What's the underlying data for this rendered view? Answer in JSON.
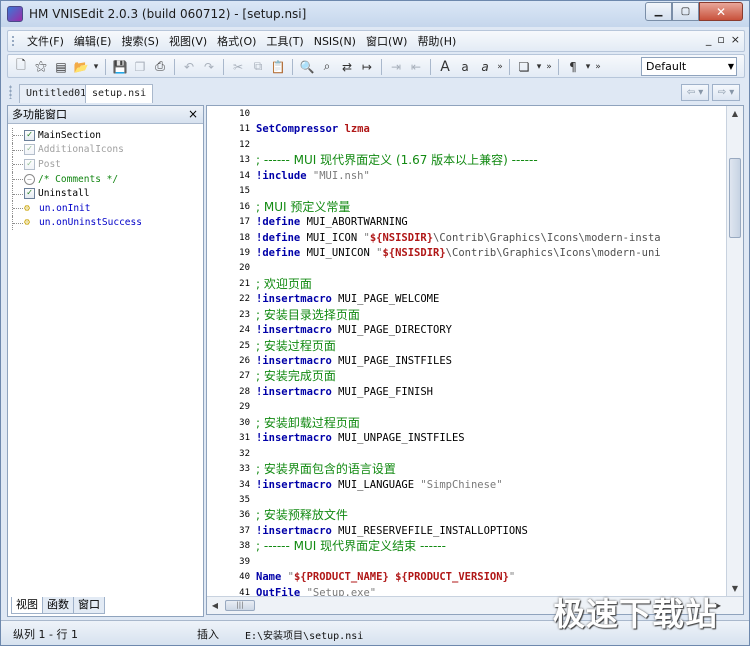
{
  "window": {
    "title": "HM VNISEdit 2.0.3 (build 060712) - [setup.nsi]"
  },
  "menu": {
    "items": [
      "文件(F)",
      "编辑(E)",
      "搜索(S)",
      "视图(V)",
      "格式(O)",
      "工具(T)",
      "NSIS(N)",
      "窗口(W)",
      "帮助(H)"
    ],
    "mdi_buttons": [
      "_",
      "▫",
      "×"
    ]
  },
  "toolbar": {
    "text_buttons": [
      "A",
      "a",
      "a"
    ],
    "paragraph_label": "¶",
    "font_select": "Default"
  },
  "tabs": [
    {
      "label": "Untitled01",
      "active": false
    },
    {
      "label": "setup.nsi",
      "active": true
    }
  ],
  "panel": {
    "title": "多功能窗口",
    "close": "×",
    "tree": [
      {
        "label": "MainSection",
        "style": "black",
        "icon": "checkbox-icon",
        "checked": true
      },
      {
        "label": "AdditionalIcons",
        "style": "gray",
        "icon": "checkbox-icon",
        "checked": true
      },
      {
        "label": "Post",
        "style": "gray",
        "icon": "checkbox-icon",
        "checked": true
      },
      {
        "label": "/* Comments */",
        "style": "green",
        "icon": "comment-icon",
        "checked": false
      },
      {
        "label": "Uninstall",
        "style": "black",
        "icon": "checkbox-icon",
        "checked": true
      },
      {
        "label": "un.onInit",
        "style": "blue",
        "icon": "function-icon",
        "checked": false
      },
      {
        "label": "un.onUninstSuccess",
        "style": "blue",
        "icon": "function-icon",
        "checked": false
      }
    ],
    "bottom_tabs": [
      "视图",
      "函数",
      "窗口"
    ]
  },
  "editor": {
    "lines": [
      {
        "n": "10",
        "parts": []
      },
      {
        "n": "11",
        "parts": [
          [
            "kw",
            "SetCompressor"
          ],
          [
            "id",
            " "
          ],
          [
            "var",
            "lzma"
          ]
        ]
      },
      {
        "n": "12",
        "parts": []
      },
      {
        "n": "13",
        "cjk": true,
        "parts": [
          [
            "cm",
            "; ------ MUI 现代界面定义 (1.67 版本以上兼容) ------"
          ]
        ]
      },
      {
        "n": "14",
        "parts": [
          [
            "kw",
            "!include"
          ],
          [
            "id",
            " "
          ],
          [
            "str",
            "\"MUI.nsh\""
          ]
        ]
      },
      {
        "n": "15",
        "parts": []
      },
      {
        "n": "16",
        "cjk": true,
        "parts": [
          [
            "cm",
            "; MUI 预定义常量"
          ]
        ]
      },
      {
        "n": "17",
        "parts": [
          [
            "kw",
            "!define"
          ],
          [
            "id",
            " MUI_ABORTWARNING"
          ]
        ]
      },
      {
        "n": "18",
        "parts": [
          [
            "kw",
            "!define"
          ],
          [
            "id",
            " MUI_ICON "
          ],
          [
            "str",
            "\""
          ],
          [
            "var",
            "${NSISDIR}"
          ],
          [
            "path",
            "\\Contrib\\Graphics\\Icons\\modern-insta"
          ]
        ]
      },
      {
        "n": "19",
        "parts": [
          [
            "kw",
            "!define"
          ],
          [
            "id",
            " MUI_UNICON "
          ],
          [
            "str",
            "\""
          ],
          [
            "var",
            "${NSISDIR}"
          ],
          [
            "path",
            "\\Contrib\\Graphics\\Icons\\modern-uni"
          ]
        ]
      },
      {
        "n": "20",
        "parts": []
      },
      {
        "n": "21",
        "cjk": true,
        "parts": [
          [
            "cm",
            "; 欢迎页面"
          ]
        ]
      },
      {
        "n": "22",
        "parts": [
          [
            "kw",
            "!insertmacro"
          ],
          [
            "id",
            " MUI_PAGE_WELCOME"
          ]
        ]
      },
      {
        "n": "23",
        "cjk": true,
        "parts": [
          [
            "cm",
            "; 安装目录选择页面"
          ]
        ]
      },
      {
        "n": "24",
        "parts": [
          [
            "kw",
            "!insertmacro"
          ],
          [
            "id",
            " MUI_PAGE_DIRECTORY"
          ]
        ]
      },
      {
        "n": "25",
        "cjk": true,
        "parts": [
          [
            "cm",
            "; 安装过程页面"
          ]
        ]
      },
      {
        "n": "26",
        "parts": [
          [
            "kw",
            "!insertmacro"
          ],
          [
            "id",
            " MUI_PAGE_INSTFILES"
          ]
        ]
      },
      {
        "n": "27",
        "cjk": true,
        "parts": [
          [
            "cm",
            "; 安装完成页面"
          ]
        ]
      },
      {
        "n": "28",
        "parts": [
          [
            "kw",
            "!insertmacro"
          ],
          [
            "id",
            " MUI_PAGE_FINISH"
          ]
        ]
      },
      {
        "n": "29",
        "parts": []
      },
      {
        "n": "30",
        "cjk": true,
        "parts": [
          [
            "cm",
            "; 安装卸载过程页面"
          ]
        ]
      },
      {
        "n": "31",
        "parts": [
          [
            "kw",
            "!insertmacro"
          ],
          [
            "id",
            " MUI_UNPAGE_INSTFILES"
          ]
        ]
      },
      {
        "n": "32",
        "parts": []
      },
      {
        "n": "33",
        "cjk": true,
        "parts": [
          [
            "cm",
            "; 安装界面包含的语言设置"
          ]
        ]
      },
      {
        "n": "34",
        "parts": [
          [
            "kw",
            "!insertmacro"
          ],
          [
            "id",
            " MUI_LANGUAGE "
          ],
          [
            "str",
            "\"SimpChinese\""
          ]
        ]
      },
      {
        "n": "35",
        "parts": []
      },
      {
        "n": "36",
        "cjk": true,
        "parts": [
          [
            "cm",
            "; 安装预释放文件"
          ]
        ]
      },
      {
        "n": "37",
        "parts": [
          [
            "kw",
            "!insertmacro"
          ],
          [
            "id",
            " MUI_RESERVEFILE_INSTALLOPTIONS"
          ]
        ]
      },
      {
        "n": "38",
        "cjk": true,
        "parts": [
          [
            "cm",
            "; ------ MUI 现代界面定义结束 ------"
          ]
        ]
      },
      {
        "n": "39",
        "parts": []
      },
      {
        "n": "40",
        "parts": [
          [
            "kw",
            "Name"
          ],
          [
            "id",
            " "
          ],
          [
            "str",
            "\""
          ],
          [
            "var",
            "${PRODUCT_NAME}"
          ],
          [
            "id",
            " "
          ],
          [
            "var",
            "${PRODUCT_VERSION}"
          ],
          [
            "str",
            "\""
          ]
        ]
      },
      {
        "n": "41",
        "parts": [
          [
            "kw",
            "OutFile"
          ],
          [
            "id",
            " "
          ],
          [
            "str",
            "\"Setup.exe\""
          ]
        ]
      }
    ]
  },
  "status": {
    "position": "纵列 1 - 行 1",
    "mode": "插入",
    "file_path": "E:\\安装项目\\setup.nsi"
  },
  "watermark": "极速下载站"
}
